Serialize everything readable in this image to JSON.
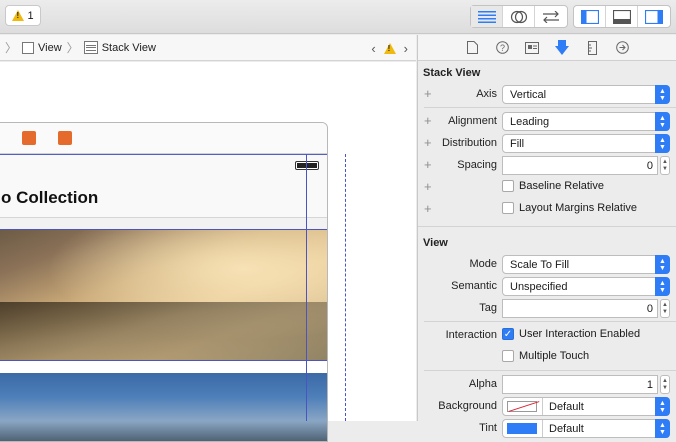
{
  "toolbar": {
    "warning_count": "1",
    "editor_buttons": [
      "standard-editor",
      "assistant-editor",
      "version-editor"
    ],
    "panel_buttons": [
      "navigator",
      "debug-area",
      "utilities"
    ]
  },
  "jumpbar": {
    "crumbs": [
      "View",
      "Stack View"
    ]
  },
  "canvas": {
    "nav_title": "o Collection"
  },
  "inspector": {
    "tabs": [
      "file-inspector",
      "quick-help",
      "identity-inspector",
      "attributes-inspector",
      "size-inspector",
      "connections-inspector"
    ],
    "stack_view": {
      "heading": "Stack View",
      "axis_label": "Axis",
      "axis_value": "Vertical",
      "alignment_label": "Alignment",
      "alignment_value": "Leading",
      "distribution_label": "Distribution",
      "distribution_value": "Fill",
      "spacing_label": "Spacing",
      "spacing_value": "0",
      "baseline_relative": "Baseline Relative",
      "layout_margins_relative": "Layout Margins Relative"
    },
    "view": {
      "heading": "View",
      "mode_label": "Mode",
      "mode_value": "Scale To Fill",
      "semantic_label": "Semantic",
      "semantic_value": "Unspecified",
      "tag_label": "Tag",
      "tag_value": "0",
      "interaction_label": "Interaction",
      "user_interaction_enabled": "User Interaction Enabled",
      "multiple_touch": "Multiple Touch",
      "alpha_label": "Alpha",
      "alpha_value": "1",
      "background_label": "Background",
      "background_value": "Default",
      "tint_label": "Tint",
      "tint_value": "Default"
    }
  },
  "colors": {
    "accent": "#2f7df6",
    "selection": "#4a54c4",
    "warning": "#f0b90d"
  }
}
